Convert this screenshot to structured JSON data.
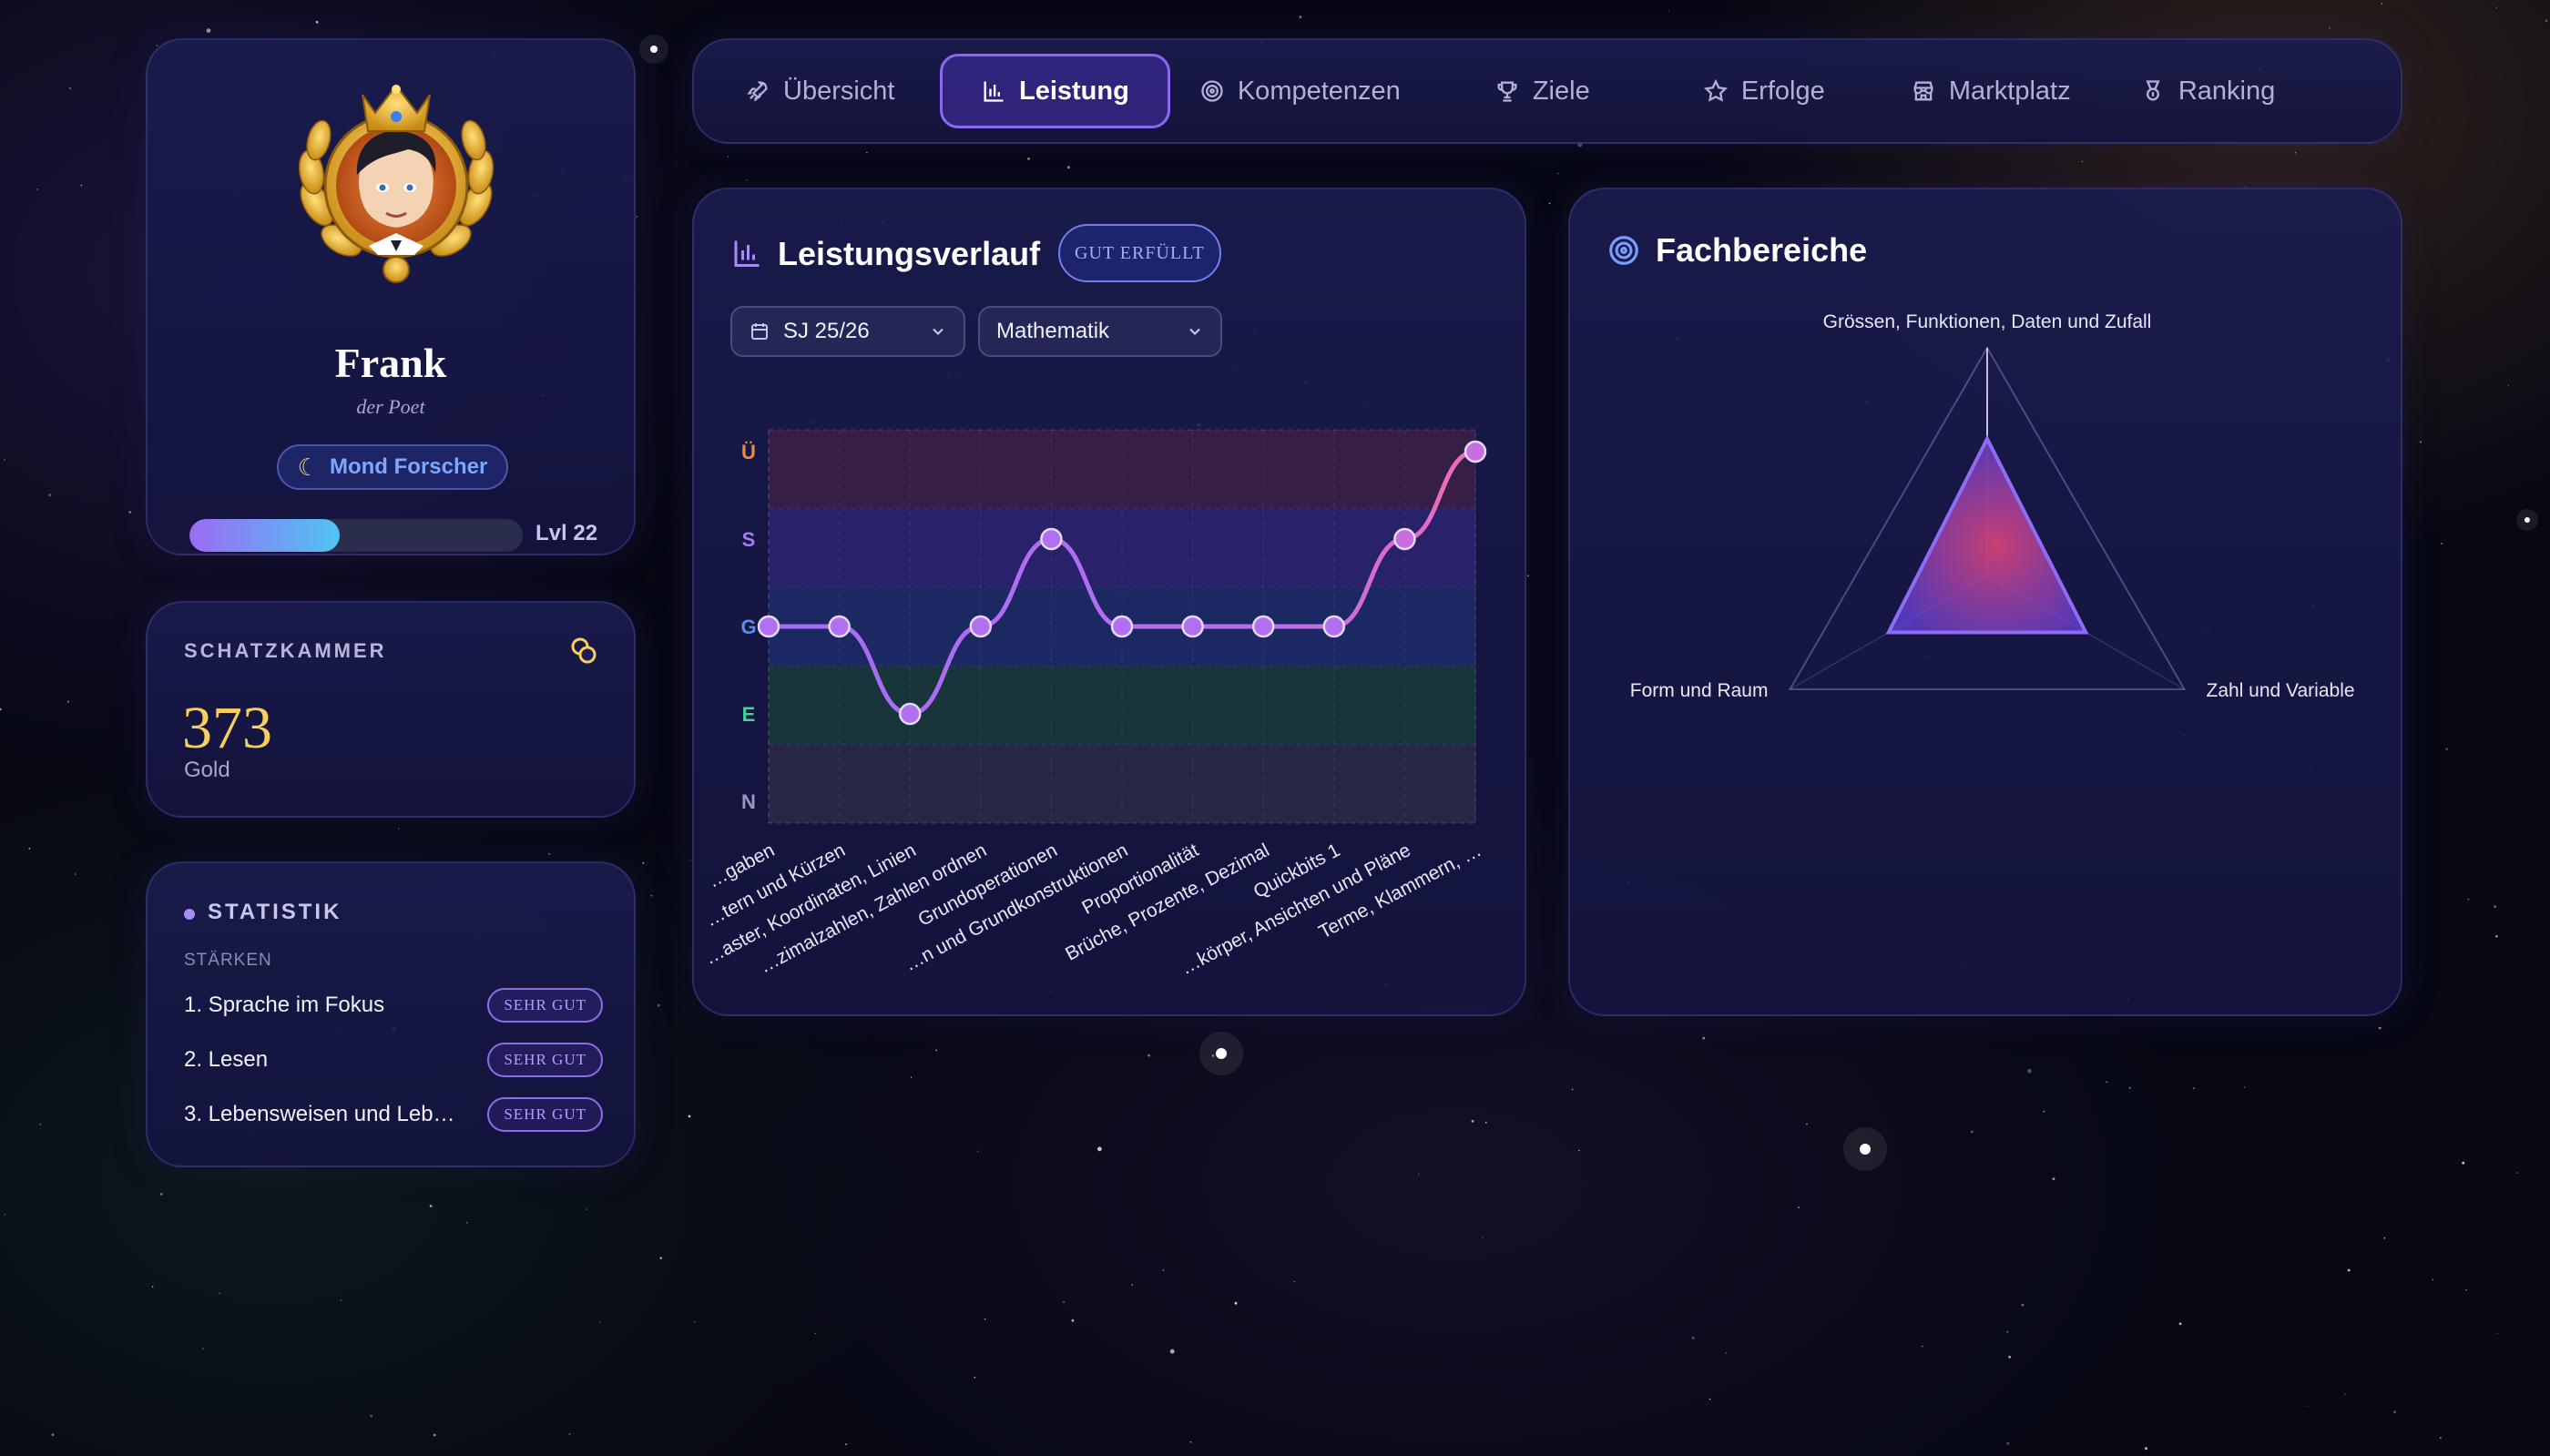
{
  "profile": {
    "name": "Frank",
    "title": "der Poet",
    "rank": "Mond Forscher",
    "level_label": "Lvl 22",
    "xp_progress": 0.45
  },
  "treasury": {
    "title": "SCHATZKAMMER",
    "amount": "373",
    "currency": "Gold"
  },
  "stats": {
    "title": "STATISTIK",
    "strengths_label": "STÄRKEN",
    "strengths": [
      {
        "label": "1. Sprache im Fokus",
        "rating": "SEHR GUT"
      },
      {
        "label": "2. Lesen",
        "rating": "SEHR GUT"
      },
      {
        "label": "3. Lebensweisen und Leb…",
        "rating": "SEHR GUT"
      }
    ]
  },
  "nav": {
    "tabs": [
      {
        "label": "Übersicht",
        "icon": "rocket-icon"
      },
      {
        "label": "Leistung",
        "icon": "bar-chart-icon",
        "active": true
      },
      {
        "label": "Kompetenzen",
        "icon": "target-icon"
      },
      {
        "label": "Ziele",
        "icon": "trophy-icon"
      },
      {
        "label": "Erfolge",
        "icon": "star-icon"
      },
      {
        "label": "Marktplatz",
        "icon": "store-icon"
      },
      {
        "label": "Ranking",
        "icon": "medal-icon"
      }
    ]
  },
  "performance": {
    "title": "Leistungsverlauf",
    "status": "GUT ERFÜLLT",
    "year_select": "SJ 25/26",
    "subject_select": "Mathematik"
  },
  "chart_data": [
    {
      "type": "line",
      "y_levels": [
        "N",
        "E",
        "G",
        "S",
        "Ü"
      ],
      "y_level_colors": [
        "#9a98c0",
        "#3fd49a",
        "#5b8cf5",
        "#a87cf0",
        "#f08a3c"
      ],
      "band_colors": [
        "#2a2846",
        "#17383a",
        "#1c2a66",
        "#2b2470",
        "#3a1f45"
      ],
      "categories": [
        "…gaben",
        "…tern und Kürzen",
        "…aster, Koordinaten, Linien",
        "…zimalzahlen, Zahlen ordnen",
        "Grundoperationen",
        "…n und Grundkonstruktionen",
        "Proportionalität",
        "Brüche, Prozente, Dezimal",
        "Quickbits 1",
        "…körper, Ansichten und Pläne",
        "Terme, Klammern, …"
      ],
      "values": [
        "G",
        "G",
        "E",
        "G",
        "S",
        "G",
        "G",
        "G",
        "G",
        "S",
        "Ü"
      ]
    },
    {
      "type": "radar",
      "title": "Fachbereiche",
      "axes": [
        "Grössen, Funktionen, Daten und Zufall",
        "Zahl und Variable",
        "Form und Raum"
      ],
      "values": [
        0.6,
        0.5,
        0.5
      ],
      "max": 1
    }
  ]
}
